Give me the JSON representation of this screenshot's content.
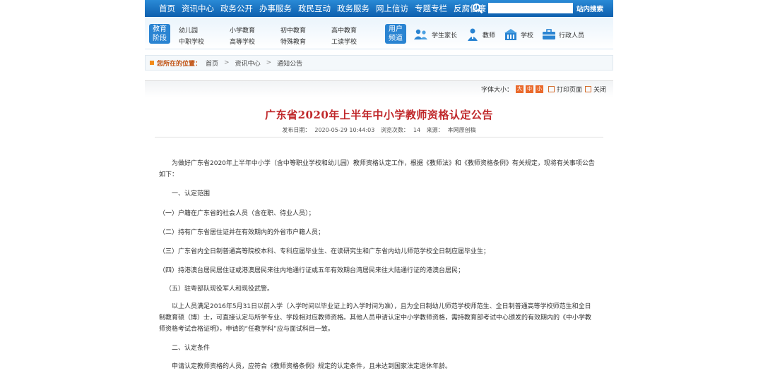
{
  "topnav": {
    "items": [
      "首页",
      "资讯中心",
      "政务公开",
      "办事服务",
      "政民互动",
      "政务服务",
      "网上信访",
      "专题专栏",
      "反腐倡廉"
    ],
    "search_placeholder": "",
    "search_button": "站内搜索"
  },
  "subnav": {
    "edu_tag": [
      "教育",
      "阶段"
    ],
    "edu_links": [
      "幼儿园",
      "小学教育",
      "初中教育",
      "高中教育",
      "中职学校",
      "高等学校",
      "特殊教育",
      "工读学校"
    ],
    "user_tag": [
      "用户",
      "频道"
    ],
    "user_links": [
      {
        "label": "学生家长",
        "icon": "parents-icon"
      },
      {
        "label": "教师",
        "icon": "teacher-icon"
      },
      {
        "label": "学校",
        "icon": "school-icon"
      },
      {
        "label": "行政人员",
        "icon": "briefcase-icon"
      }
    ]
  },
  "breadcrumb": {
    "label": "您所在的位置：",
    "items": [
      "首页",
      "资讯中心",
      "通知公告"
    ]
  },
  "toolbar": {
    "font_size_label": "字体大小：",
    "font_sizes": [
      "大",
      "中",
      "小"
    ],
    "print": "打印页面",
    "close": "关闭"
  },
  "article": {
    "title": "广东省2020年上半年中小学教师资格认定公告",
    "publish_label": "发布日期：",
    "publish_date": "2020-05-29 10:44:03",
    "views_label": "浏览次数：",
    "views": "14",
    "source_label": "来源：",
    "source": "本网原创稿",
    "paragraphs": [
      "为做好广东省2020年上半年中小学（含中等职业学校和幼儿园）教师资格认定工作，根据《教师法》和《教师资格条例》有关规定，现将有关事项公告如下：",
      "一、认定范围",
      "（一）户籍在广东省的社会人员（含在职、待业人员）；",
      "（二）持有广东省居住证并在有效期内的外省市户籍人员；",
      "（三）广东省内全日制普通高等院校本科、专科应届毕业生、在读研究生和广东省内幼儿师范学校全日制应届毕业生；",
      "（四）持港澳台居民居住证或港澳居民来往内地通行证或五年有效期台湾居民来往大陆通行证的港澳台居民；",
      "（五）驻粤部队现役军人和现役武警。",
      "以上人员满足2016年5月31日以前入学（入学时间以毕业证上的入学时间为准），且为全日制幼儿师范学校师范生、全日制普通高等学校师范生和全日制教育硕（博）士，可直接认定与所学专业、学段相对应教师资格。其他人员申请认定中小学教师资格，需持教育部考试中心颁发的有效期内的《中小学教师资格考试合格证明》，申请的“任教学科”应与面试科目一致。",
      "二、认定条件",
      "申请认定教师资格的人员，应符合《教师资格条例》规定的认定条件，且未达到国家法定退休年龄。"
    ]
  },
  "colors": {
    "nav_blue": "#0d5fae",
    "title_red": "#c0282b",
    "accent_orange": "#ea6a2c"
  }
}
